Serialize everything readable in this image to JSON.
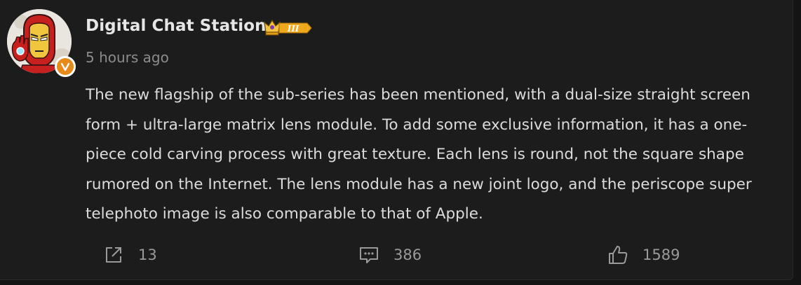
{
  "post": {
    "author": {
      "name": "Digital Chat Station",
      "rank_badge_text": "III",
      "verified_badge_letter": "v",
      "avatar_icon": "iron-man-avatar"
    },
    "timestamp": "5 hours ago",
    "body": "The new flagship of the sub-series has been mentioned, with a dual-size straight screen form + ultra-large matrix lens module. To add some exclusive information, it has a one-piece cold carving process with great texture. Each lens is round, not the square shape rumored on the Internet. The lens module has a new joint logo, and the periscope super telephoto image is also comparable to that of Apple.",
    "actions": {
      "share": {
        "icon": "share-icon",
        "count": "13"
      },
      "comment": {
        "icon": "comment-icon",
        "count": "386"
      },
      "like": {
        "icon": "thumbs-up-icon",
        "count": "1589"
      }
    }
  },
  "colors": {
    "background": "#1c1c1c",
    "text_primary": "#dcdcdc",
    "text_secondary": "#8c8c8c",
    "verified_badge": "#e88a1a",
    "rank_badge": "#f0a81c"
  }
}
